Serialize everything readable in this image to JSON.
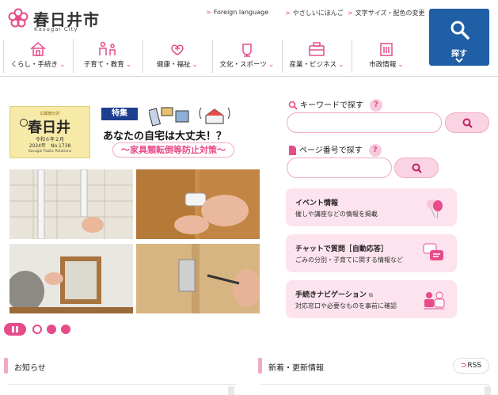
{
  "header": {
    "city_name": "春日井市",
    "city_name_en": "Kasugai City",
    "links": [
      {
        "label": "Foreign language"
      },
      {
        "label": "やさしいにほんご"
      },
      {
        "label": "文字サイズ・配色の変更"
      }
    ],
    "search_button": {
      "label": "探す",
      "icon": "search-icon"
    }
  },
  "nav": {
    "items": [
      {
        "label": "くらし・手続き",
        "icon": "house-icon"
      },
      {
        "label": "子育て・教育",
        "icon": "family-icon"
      },
      {
        "label": "健康・福祉",
        "icon": "health-icon"
      },
      {
        "label": "文化・スポーツ",
        "icon": "culture-icon"
      },
      {
        "label": "産業・ビジネス",
        "icon": "briefcase-icon"
      },
      {
        "label": "市政情報",
        "icon": "building-icon"
      }
    ]
  },
  "banner": {
    "koho": {
      "header": "広報春日井",
      "title": "春日井",
      "date": "令和６年２月",
      "issue": "2024年　No.1738",
      "en": "Kasugai Public Relations"
    },
    "tag": "特集",
    "headline": "あなたの自宅は大丈夫！？",
    "subheadline": "〜家具類転倒等防止対策〜"
  },
  "carousel": {
    "dot_colors": [
      "#ffffff",
      "#e64b8a",
      "#e64b8a"
    ]
  },
  "search": {
    "keyword_label": "キーワードで探す",
    "keyword_value": "",
    "page_label": "ページ番号で探す",
    "page_value": "",
    "help": "?"
  },
  "cards": [
    {
      "title": "イベント情報",
      "desc": "催しや講座などの情報を掲載",
      "icon": "balloon-icon"
    },
    {
      "title": "チャットで質問［自動応答］",
      "desc": "ごみの分別・子育てに関する情報など",
      "icon": "chat-icon"
    },
    {
      "title": "手続きナビゲーション",
      "desc": "対応窓口や必要なものを事前に確認",
      "icon": "navigation-icon"
    }
  ],
  "sections": {
    "news": "お知らせ",
    "updates": "新着・更新情報",
    "rss": "RSS"
  },
  "colors": {
    "accent": "#e64b8a",
    "brand_blue": "#1f5fa6",
    "card_bg": "#fde3ee"
  }
}
